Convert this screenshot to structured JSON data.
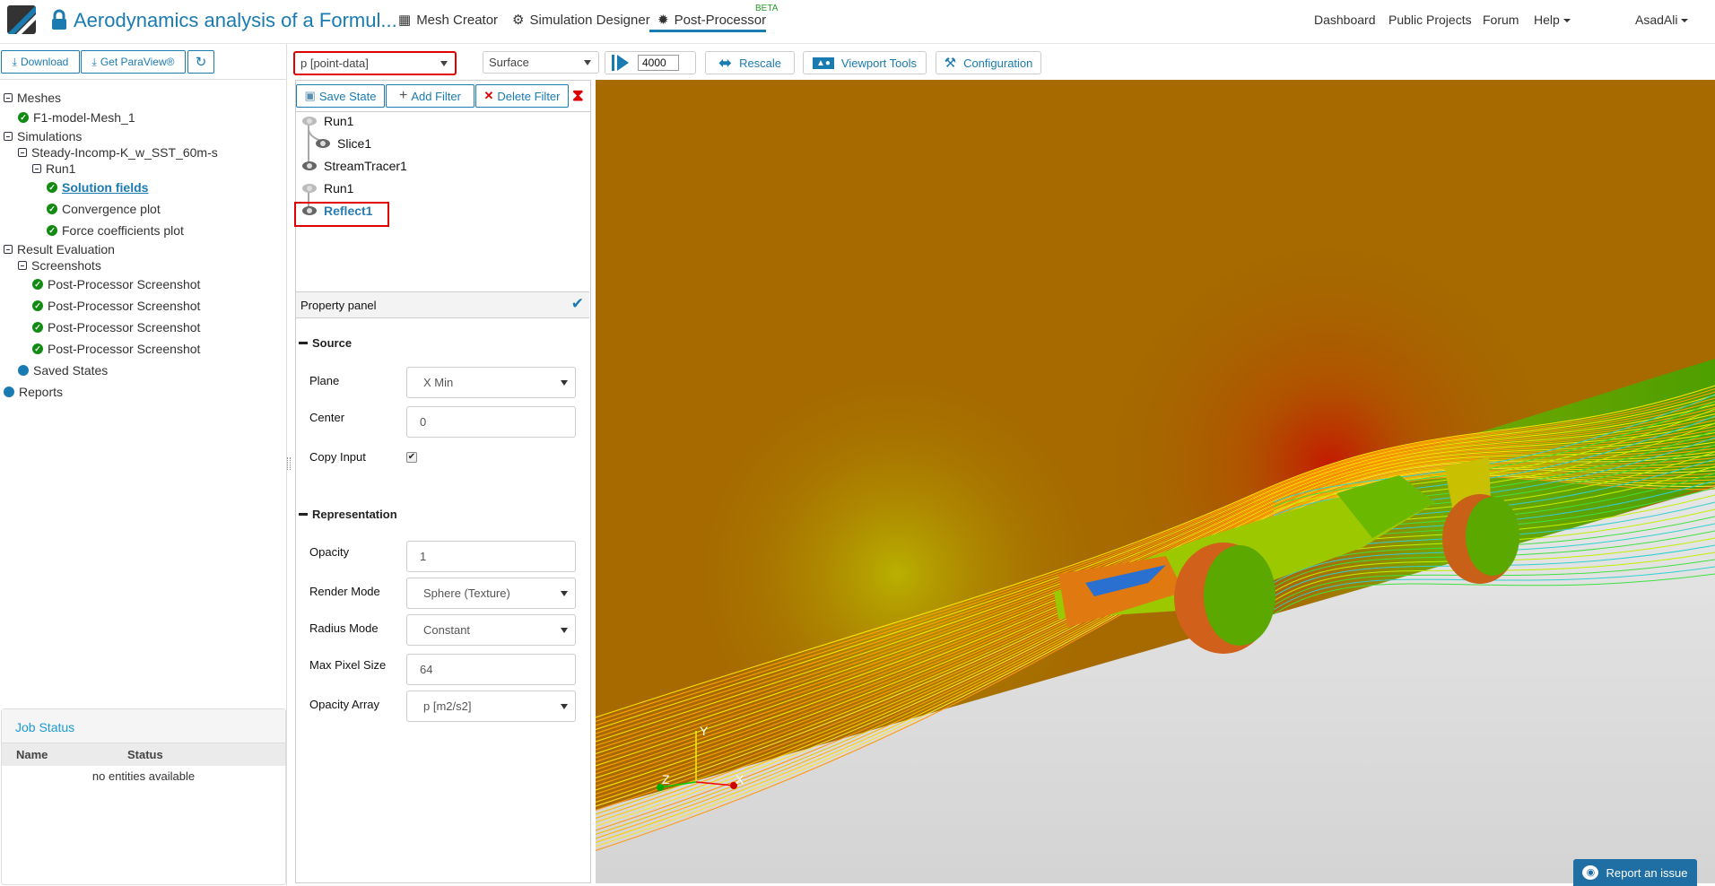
{
  "header": {
    "title": "Aerodynamics analysis of a Formul...",
    "nav": [
      {
        "label": "Mesh Creator",
        "icon": "grid-icon"
      },
      {
        "label": "Simulation Designer",
        "icon": "gears-icon"
      },
      {
        "label": "Post-Processor",
        "icon": "gear-icon",
        "badge": "BETA",
        "active": true
      }
    ],
    "right": [
      "Dashboard",
      "Public Projects",
      "Forum",
      "Help"
    ],
    "user": "AsadAli"
  },
  "left_toolbar": {
    "download": "Download",
    "paraview": "Get ParaView®"
  },
  "tree": {
    "meshes": "Meshes",
    "mesh1": "F1-model-Mesh_1",
    "simulations": "Simulations",
    "sim1": "Steady-Incomp-K_w_SST_60m-s",
    "run1": "Run1",
    "solution": "Solution fields",
    "convergence": "Convergence plot",
    "force": "Force coefficients plot",
    "result_eval": "Result Evaluation",
    "screenshots": "Screenshots",
    "shots": [
      "Post-Processor Screenshot",
      "Post-Processor Screenshot",
      "Post-Processor Screenshot",
      "Post-Processor Screenshot"
    ],
    "saved_states": "Saved States",
    "reports": "Reports"
  },
  "job_status": {
    "title": "Job Status",
    "col_name": "Name",
    "col_status": "Status",
    "empty": "no entities available"
  },
  "toolbar": {
    "field": "p [point-data]",
    "representation": "Surface",
    "time": "4000",
    "rescale": "Rescale",
    "viewport_tools": "Viewport Tools",
    "configuration": "Configuration"
  },
  "pipeline": {
    "save_state": "Save State",
    "add_filter": "Add Filter",
    "delete_filter": "Delete Filter",
    "items": [
      "Run1",
      "Slice1",
      "StreamTracer1",
      "Run1",
      "Reflect1"
    ]
  },
  "property_panel": {
    "title": "Property panel",
    "source": "Source",
    "plane_label": "Plane",
    "plane": "X Min",
    "center_label": "Center",
    "center": "0",
    "copy_input_label": "Copy Input",
    "copy_input": true,
    "representation": "Representation",
    "opacity_label": "Opacity",
    "opacity": "1",
    "render_mode_label": "Render Mode",
    "render_mode": "Sphere (Texture)",
    "radius_mode_label": "Radius Mode",
    "radius_mode": "Constant",
    "max_pixel_label": "Max Pixel Size",
    "max_pixel": "64",
    "opacity_array_label": "Opacity Array",
    "opacity_array": "p [m2/s2]"
  },
  "viewport": {
    "axes": {
      "x": "X",
      "y": "Y",
      "z": "Z"
    }
  },
  "report_issue": "Report an issue",
  "colors": {
    "accent": "#1a7bb1",
    "ok": "#138a13",
    "highlight": "#e00000"
  }
}
